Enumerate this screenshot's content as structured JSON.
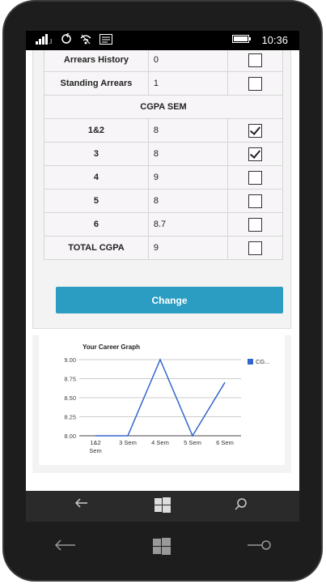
{
  "status": {
    "time": "10:36"
  },
  "table": {
    "rows_top": [
      {
        "label": "Arrears History",
        "value": "0",
        "checked": false
      },
      {
        "label": "Standing Arrears",
        "value": "1",
        "checked": false
      }
    ],
    "section_header": "CGPA SEM",
    "rows_sem": [
      {
        "label": "1&2",
        "value": "8",
        "checked": true
      },
      {
        "label": "3",
        "value": "8",
        "checked": true
      },
      {
        "label": "4",
        "value": "9",
        "checked": false
      },
      {
        "label": "5",
        "value": "8",
        "checked": false
      },
      {
        "label": "6",
        "value": "8.7",
        "checked": false
      },
      {
        "label": "TOTAL CGPA",
        "value": "9",
        "checked": false
      }
    ]
  },
  "change_button": "Change",
  "chart_data": {
    "type": "line",
    "title": "Your Career Graph",
    "categories": [
      "1&2 Sem",
      "3 Sem",
      "4 Sem",
      "5 Sem",
      "6 Sem"
    ],
    "series": [
      {
        "name": "CG...",
        "values": [
          8.0,
          8.0,
          9.0,
          8.0,
          8.7
        ],
        "color": "#3366cc"
      }
    ],
    "ylim": [
      8.0,
      9.0
    ],
    "yticks": [
      "9.00",
      "8.75",
      "8.50",
      "8.25",
      "8.00"
    ],
    "grid": true,
    "legend": "right"
  },
  "appbar": {
    "more": "•••"
  },
  "icons": {
    "signal": "signal-icon",
    "wifi": "wifi-icon",
    "battery": "battery-icon",
    "back": "back-arrow-icon",
    "windows": "windows-logo-icon",
    "search": "search-icon",
    "more": "more-icon"
  }
}
